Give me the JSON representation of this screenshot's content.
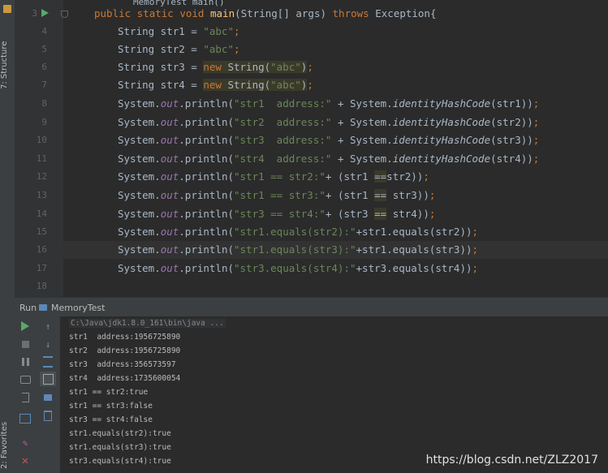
{
  "left_toolbar": {
    "structure_label": "7: Structure",
    "favorites_label": "2: Favorites"
  },
  "editor": {
    "breadcrumb": "MemoryTest  main()",
    "lines": [
      {
        "num": "3",
        "text": "public static void main(String[] args) throws Exception{"
      },
      {
        "num": "4",
        "text": "String str1 = \"abc\";"
      },
      {
        "num": "5",
        "text": "String str2 = \"abc\";"
      },
      {
        "num": "6",
        "text": "String str3 = new String(\"abc\");"
      },
      {
        "num": "7",
        "text": "String str4 = new String(\"abc\");"
      },
      {
        "num": "8",
        "text": "System.out.println(\"str1  address:\" + System.identityHashCode(str1));"
      },
      {
        "num": "9",
        "text": "System.out.println(\"str2  address:\" + System.identityHashCode(str2));"
      },
      {
        "num": "10",
        "text": "System.out.println(\"str3  address:\" + System.identityHashCode(str3));"
      },
      {
        "num": "11",
        "text": "System.out.println(\"str4  address:\" + System.identityHashCode(str4));"
      },
      {
        "num": "12",
        "text": "System.out.println(\"str1 == str2:\"+ (str1 ==str2));"
      },
      {
        "num": "13",
        "text": "System.out.println(\"str1 == str3:\"+ (str1 == str3));"
      },
      {
        "num": "14",
        "text": "System.out.println(\"str3 == str4:\"+ (str3 == str4));"
      },
      {
        "num": "15",
        "text": "System.out.println(\"str1.equals(str2):\"+str1.equals(str2));"
      },
      {
        "num": "16",
        "text": "System.out.println(\"str1.equals(str3):\"+str1.equals(str3));"
      },
      {
        "num": "17",
        "text": "System.out.println(\"str3.equals(str4):\"+str3.equals(str4));"
      },
      {
        "num": "18",
        "text": ""
      }
    ]
  },
  "run_panel": {
    "title": "Run",
    "config_name": "MemoryTest",
    "command": "C:\\Java\\jdk1.8.0_161\\bin\\java ...",
    "output": [
      "str1  address:1956725890",
      "str2  address:1956725890",
      "str3  address:356573597",
      "str4  address:1735600054",
      "str1 == str2:true",
      "str1 == str3:false",
      "str3 == str4:false",
      "str1.equals(str2):true",
      "str1.equals(str3):true",
      "str3.equals(str4):true"
    ]
  },
  "watermark": "https://blog.csdn.net/ZLZ2017",
  "colors": {
    "background": "#2b2b2b",
    "keyword": "#cc7832",
    "string": "#6a8759",
    "static_field": "#9876aa",
    "run_green": "#59a869",
    "stop_red": "#c75450"
  }
}
